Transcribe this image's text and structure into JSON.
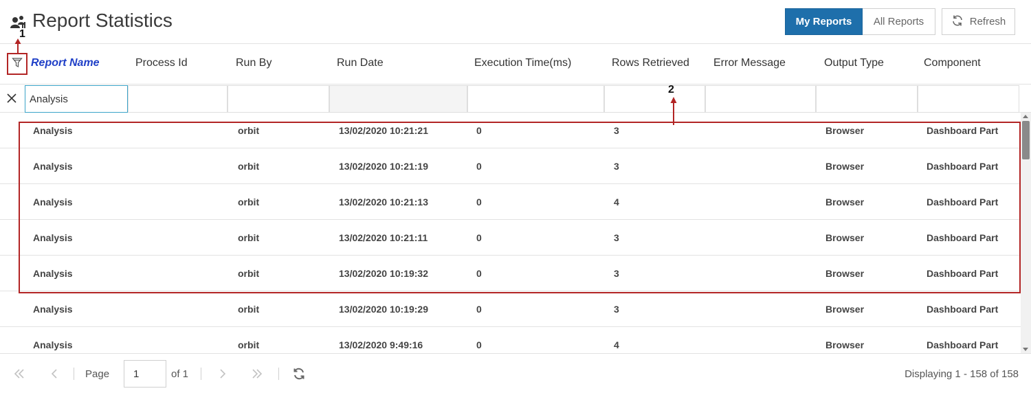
{
  "header": {
    "title": "Report Statistics",
    "title_icon": "users-chart-icon",
    "toggle": {
      "my_reports": "My Reports",
      "all_reports": "All Reports",
      "selected": "My Reports"
    },
    "refresh_label": "Refresh"
  },
  "columns": [
    {
      "key": "report_name",
      "label": "Report Name",
      "active": true
    },
    {
      "key": "process_id",
      "label": "Process Id"
    },
    {
      "key": "run_by",
      "label": "Run By"
    },
    {
      "key": "run_date",
      "label": "Run Date"
    },
    {
      "key": "execution_time",
      "label": "Execution Time(ms)"
    },
    {
      "key": "rows_retrieved",
      "label": "Rows Retrieved"
    },
    {
      "key": "error_message",
      "label": "Error Message"
    },
    {
      "key": "output_type",
      "label": "Output Type"
    },
    {
      "key": "component",
      "label": "Component"
    }
  ],
  "filters": {
    "report_name": "Analysis",
    "process_id": "",
    "run_by": "",
    "run_date": "",
    "execution_time": "",
    "rows_retrieved": "",
    "error_message": "",
    "output_type": "",
    "component": ""
  },
  "rows": [
    {
      "report_name": "Analysis",
      "process_id": "",
      "run_by": "orbit",
      "run_date": "13/02/2020 10:21:21",
      "execution_time": "0",
      "rows_retrieved": "3",
      "error_message": "",
      "output_type": "Browser",
      "component": "Dashboard Part"
    },
    {
      "report_name": "Analysis",
      "process_id": "",
      "run_by": "orbit",
      "run_date": "13/02/2020 10:21:19",
      "execution_time": "0",
      "rows_retrieved": "3",
      "error_message": "",
      "output_type": "Browser",
      "component": "Dashboard Part"
    },
    {
      "report_name": "Analysis",
      "process_id": "",
      "run_by": "orbit",
      "run_date": "13/02/2020 10:21:13",
      "execution_time": "0",
      "rows_retrieved": "4",
      "error_message": "",
      "output_type": "Browser",
      "component": "Dashboard Part"
    },
    {
      "report_name": "Analysis",
      "process_id": "",
      "run_by": "orbit",
      "run_date": "13/02/2020 10:21:11",
      "execution_time": "0",
      "rows_retrieved": "3",
      "error_message": "",
      "output_type": "Browser",
      "component": "Dashboard Part"
    },
    {
      "report_name": "Analysis",
      "process_id": "",
      "run_by": "orbit",
      "run_date": "13/02/2020 10:19:32",
      "execution_time": "0",
      "rows_retrieved": "3",
      "error_message": "",
      "output_type": "Browser",
      "component": "Dashboard Part"
    },
    {
      "report_name": "Analysis",
      "process_id": "",
      "run_by": "orbit",
      "run_date": "13/02/2020 10:19:29",
      "execution_time": "0",
      "rows_retrieved": "3",
      "error_message": "",
      "output_type": "Browser",
      "component": "Dashboard Part"
    },
    {
      "report_name": "Analysis",
      "process_id": "",
      "run_by": "orbit",
      "run_date": "13/02/2020 9:49:16",
      "execution_time": "0",
      "rows_retrieved": "4",
      "error_message": "",
      "output_type": "Browser",
      "component": "Dashboard Part"
    }
  ],
  "pager": {
    "page_label": "Page",
    "current_page": "1",
    "of_label": "of 1",
    "display_text": "Displaying 1 - 158 of 158"
  },
  "annotations": {
    "marker_1": "1",
    "marker_2": "2",
    "color": "#b22424"
  },
  "colors": {
    "accent": "#1e6fab",
    "active_header": "#1f3fc7",
    "annotation": "#b22424"
  }
}
